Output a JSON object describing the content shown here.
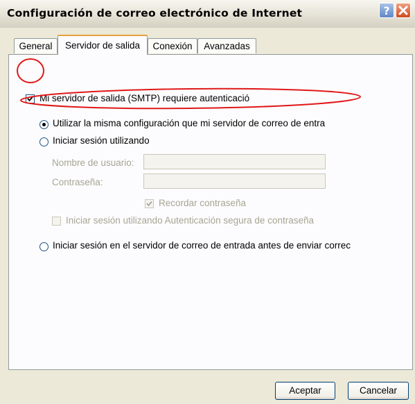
{
  "window": {
    "title": "Configuración de correo electrónico de Internet"
  },
  "tabs": [
    {
      "label": "General",
      "active": false
    },
    {
      "label": "Servidor de salida",
      "active": true
    },
    {
      "label": "Conexión",
      "active": false
    },
    {
      "label": "Avanzadas",
      "active": false
    }
  ],
  "outgoing": {
    "requires_auth": {
      "label": "Mi servidor de salida (SMTP) requiere autenticació",
      "checked": true
    },
    "option_same_settings": {
      "label": "Utilizar la misma configuración que mi servidor de correo de entra",
      "selected": true
    },
    "option_login_using": {
      "label": "Iniciar sesión utilizando",
      "selected": false
    },
    "username": {
      "label": "Nombre de usuario:",
      "value": ""
    },
    "password": {
      "label": "Contraseña:",
      "value": ""
    },
    "remember_password": {
      "label": "Recordar contraseña",
      "checked": true
    },
    "spa_login": {
      "label": "Iniciar sesión utilizando Autenticación segura de contraseña",
      "checked": false
    },
    "option_login_incoming_first": {
      "label": "Iniciar sesión en el servidor de correo de entrada antes de enviar correc",
      "selected": false
    }
  },
  "buttons": {
    "ok": "Aceptar",
    "cancel": "Cancelar"
  },
  "colors": {
    "annotation": "#e01818",
    "active_tab_accent": "#e6a23a",
    "title_close": "#d04a1e",
    "title_help": "#5f86c7"
  },
  "icons": [
    "help-icon",
    "close-icon",
    "checkmark-icon"
  ]
}
